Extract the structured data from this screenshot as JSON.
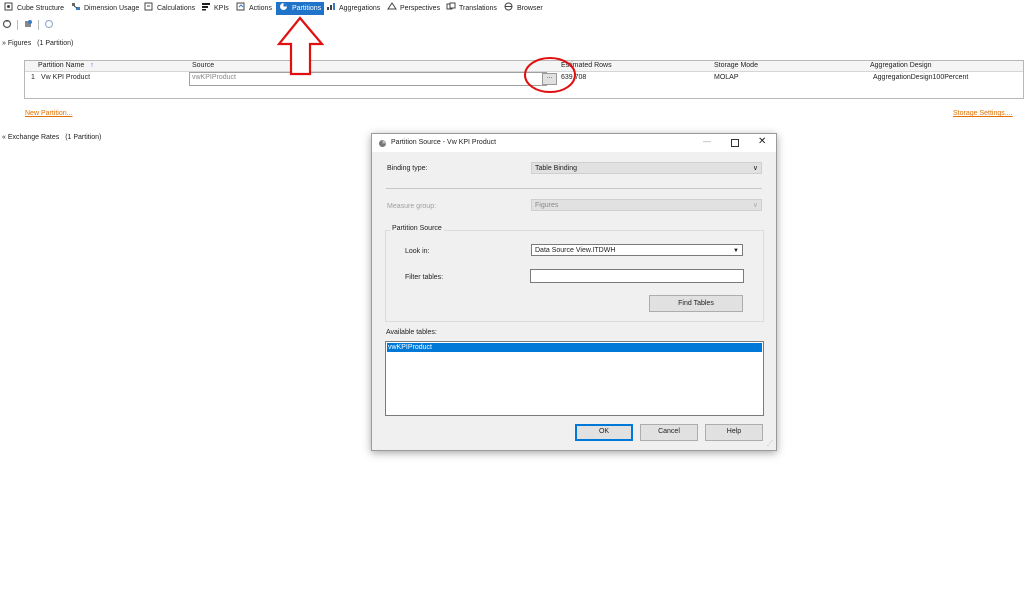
{
  "tabs": [
    {
      "label": "Cube Structure",
      "icon": "cube-structure-icon"
    },
    {
      "label": "Dimension Usage",
      "icon": "dimension-usage-icon"
    },
    {
      "label": "Calculations",
      "icon": "calculations-icon"
    },
    {
      "label": "KPIs",
      "icon": "kpis-icon"
    },
    {
      "label": "Actions",
      "icon": "actions-icon"
    },
    {
      "label": "Partitions",
      "icon": "partitions-icon",
      "active": true
    },
    {
      "label": "Aggregations",
      "icon": "aggregations-icon"
    },
    {
      "label": "Perspectives",
      "icon": "perspectives-icon"
    },
    {
      "label": "Translations",
      "icon": "translations-icon"
    },
    {
      "label": "Browser",
      "icon": "browser-icon"
    }
  ],
  "figures": {
    "header": "Figures",
    "count": "(1 Partition)",
    "columns": [
      "Partition Name",
      "Source",
      "Estimated Rows",
      "Storage Mode",
      "Aggregation Design"
    ],
    "row": {
      "index": "1",
      "name": "Vw KPI Product",
      "source": "vwKPIProduct",
      "browse": "...",
      "rows": "639,708",
      "storage": "MOLAP",
      "aggdesign": "AggregationDesign100Percent"
    },
    "new_partition": "New Partition...",
    "storage_settings": "Storage Settings...."
  },
  "exchange": {
    "header": "Exchange Rates",
    "count": "(1 Partition)"
  },
  "dialog": {
    "title": "Partition Source - Vw KPI Product",
    "binding_label": "Binding type:",
    "binding_value": "Table Binding",
    "measure_label": "Measure group:",
    "measure_value": "Figures",
    "group_title": "Partition Source",
    "lookin_label": "Look in:",
    "lookin_value": "Data Source View.ITDWH",
    "filter_label": "Filter tables:",
    "filter_value": "",
    "find_tables": "Find Tables",
    "available_label": "Available tables:",
    "tables": [
      "vwKPIProduct"
    ],
    "ok": "OK",
    "cancel": "Cancel",
    "help": "Help"
  },
  "colors": {
    "accent": "#1f73c8",
    "link": "#e07000",
    "annotation": "#e01010",
    "selection": "#0078d7"
  }
}
